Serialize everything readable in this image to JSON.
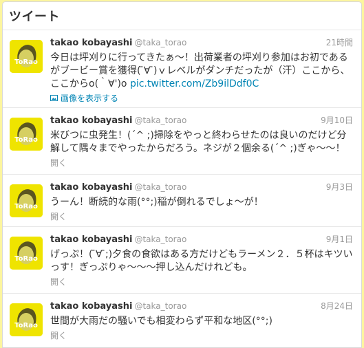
{
  "panel": {
    "title": "ツイート"
  },
  "tweets": [
    {
      "name": "takao kobayashi",
      "handle": "@taka_torao",
      "time": "21時間",
      "text": "今日は坪刈りに行ってきたぁ〜！出荷業者の坪刈り参加はお初であるがブービー賞を獲得( ̄∀ ̄)ｖレベルがダンチだったが（汗）ここから、ここからo(｀∀')o",
      "link": "pic.twitter.com/Zb9ilDdf0C",
      "action": "画像を表示する",
      "avatar_text": "ToRao"
    },
    {
      "name": "takao kobayashi",
      "handle": "@taka_torao",
      "time": "9月10日",
      "text": "米びつに虫発生！(´^ ;)掃除をやっと終わらせたのは良いのだけど分解して隅々までやったからだろう。ネジが２個余る(´^ ;)ぎゃ〜〜！",
      "action": "開く",
      "avatar_text": "ToRao"
    },
    {
      "name": "takao kobayashi",
      "handle": "@taka_torao",
      "time": "9月3日",
      "text": "うーん！断続的な雨(°°;)稲が倒れるでしょ〜が！",
      "action": "開く",
      "avatar_text": "ToRao"
    },
    {
      "name": "takao kobayashi",
      "handle": "@taka_torao",
      "time": "9月1日",
      "text": "げっぷ！( ̄∀ ̄;)夕食の食欲はある方だけどもラーメン２．５杯はキツいっす！ぎっぷりゃ〜〜〜押し込んだけれども。",
      "action": "開く",
      "avatar_text": "ToRao"
    },
    {
      "name": "takao kobayashi",
      "handle": "@taka_torao",
      "time": "8月24日",
      "text": "世間が大雨だの騒いでも相変わらず平和な地区(°°;)",
      "action": "開く",
      "avatar_text": "ToRao"
    }
  ]
}
